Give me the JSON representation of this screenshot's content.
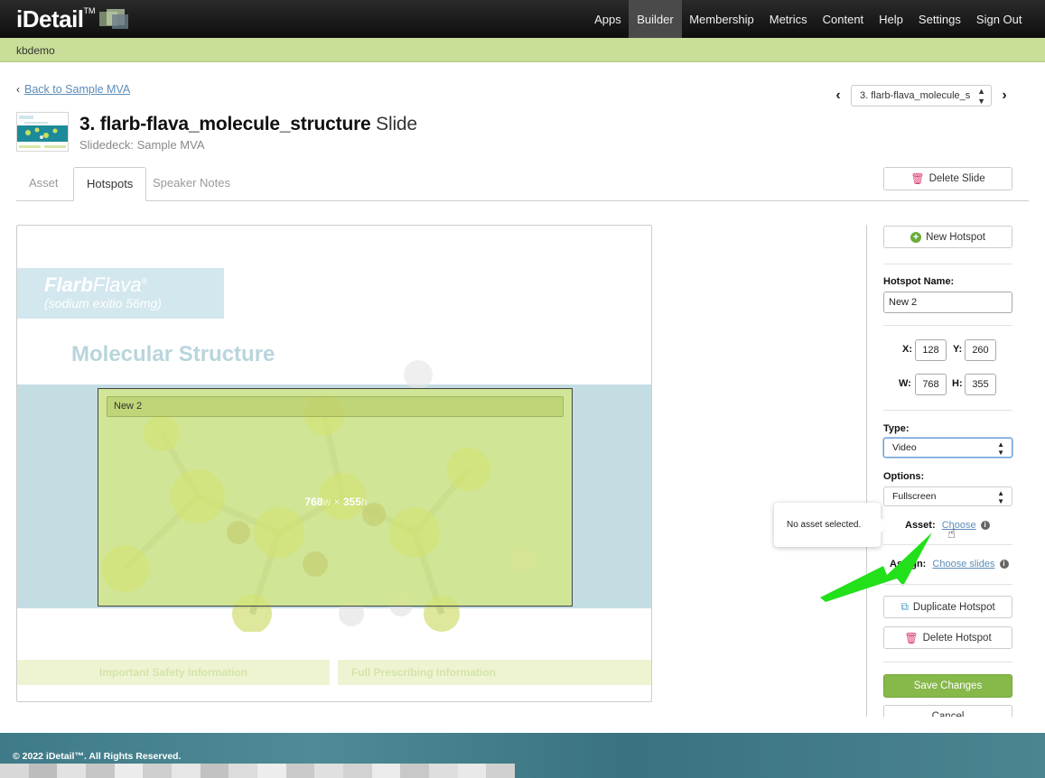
{
  "brand": {
    "name": "iDetail",
    "tm": "TM"
  },
  "nav": {
    "items": [
      "Apps",
      "Builder",
      "Membership",
      "Metrics",
      "Content",
      "Help",
      "Settings",
      "Sign Out"
    ],
    "active": "Builder"
  },
  "userbar": {
    "username": "kbdemo"
  },
  "header": {
    "back_label": "Back to Sample MVA",
    "slide_select_value": "3. flarb-flava_molecule_s",
    "title_bold": "3. flarb-flava_molecule_structure",
    "title_light": "Slide",
    "subtitle": "Slidedeck: Sample MVA"
  },
  "tabs": [
    {
      "label": "Asset",
      "active": false
    },
    {
      "label": "Hotspots",
      "active": true
    },
    {
      "label": "Speaker Notes",
      "active": false
    }
  ],
  "delete_slide_label": "Delete Slide",
  "slide": {
    "brand_name_bold": "Flarb",
    "brand_name_light": "Flava",
    "brand_reg": "®",
    "brand_sub": "(sodium exitio 56mg)",
    "heading": "Molecular Structure",
    "hotspot_label": "New 2",
    "hotspot_w": "768",
    "hotspot_h": "355",
    "unit_w": "w",
    "unit_h": "h",
    "times": "×",
    "link_safety": "Important Safety Information",
    "link_prescribing": "Full Prescribing Information"
  },
  "panel": {
    "new_hotspot_label": "New Hotspot",
    "hotspot_name_label": "Hotspot Name:",
    "hotspot_name_value": "New 2",
    "x_label": "X:",
    "x_value": "128",
    "y_label": "Y:",
    "y_value": "260",
    "w_label": "W:",
    "w_value": "768",
    "h_label": "H:",
    "h_value": "355",
    "type_label": "Type:",
    "type_value": "Video",
    "options_label": "Options:",
    "options_value": "Fullscreen",
    "asset_label": "Asset:",
    "asset_link": "Choose",
    "assign_label": "Assign:",
    "assign_link": "Choose slides",
    "tooltip_text": "No asset selected.",
    "duplicate_label": "Duplicate Hotspot",
    "delete_hotspot_label": "Delete Hotspot",
    "save_label": "Save Changes",
    "cancel_label": "Cancel",
    "info_glyph": "i"
  },
  "footer": {
    "copyright": "© 2022 iDetail™.  All Rights Reserved."
  },
  "colors": {
    "nav_bg": "#1a1a1a",
    "userbar_bg": "#c9de98",
    "link": "#5b8db8",
    "save_green": "#86b84a",
    "hotspot_fill": "#d6e878",
    "arrow_green": "#22e01a",
    "footer_teal": "#437d8a"
  }
}
